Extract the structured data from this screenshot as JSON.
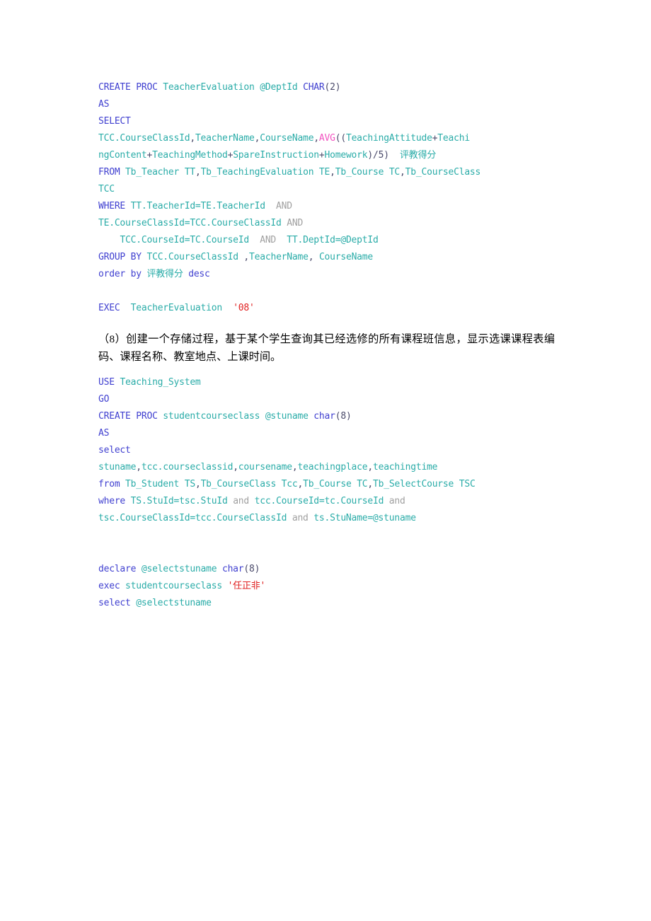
{
  "document": {
    "language": "zh-CN",
    "page_background": "#ffffff",
    "syntax_colors": {
      "keyword": "#4040D0",
      "identifier": "#2AACA8",
      "function": "#F252C0",
      "string": "#E02020",
      "operator_gray": "#A0A0A0",
      "punctuation": "#4a4a6a",
      "prose": "#000000"
    }
  },
  "blocks": [
    {
      "name": "teacher-evaluation-procedure",
      "type": "code",
      "lines": [
        [
          {
            "t": "CREATE",
            "c": "kw"
          },
          {
            "t": " ",
            "c": "pun"
          },
          {
            "t": "PROC",
            "c": "kw"
          },
          {
            "t": " ",
            "c": "pun"
          },
          {
            "t": "TeacherEvaluation",
            "c": "id"
          },
          {
            "t": " ",
            "c": "pun"
          },
          {
            "t": "@DeptId",
            "c": "id"
          },
          {
            "t": " ",
            "c": "pun"
          },
          {
            "t": "CHAR",
            "c": "kw"
          },
          {
            "t": "(2)",
            "c": "pun"
          }
        ],
        [
          {
            "t": "AS",
            "c": "kw"
          }
        ],
        [
          {
            "t": "SELECT",
            "c": "kw"
          }
        ],
        [
          {
            "t": "TCC.CourseClassId",
            "c": "id"
          },
          {
            "t": ",",
            "c": "pun"
          },
          {
            "t": "TeacherName",
            "c": "id"
          },
          {
            "t": ",",
            "c": "pun"
          },
          {
            "t": "CourseName",
            "c": "id"
          },
          {
            "t": ",",
            "c": "pun"
          },
          {
            "t": "AVG",
            "c": "fn"
          },
          {
            "t": "((",
            "c": "pun"
          },
          {
            "t": "TeachingAttitude",
            "c": "id"
          },
          {
            "t": "+",
            "c": "pun"
          },
          {
            "t": "Teachi",
            "c": "id"
          }
        ],
        [
          {
            "t": "ngContent",
            "c": "id"
          },
          {
            "t": "+",
            "c": "pun"
          },
          {
            "t": "TeachingMethod",
            "c": "id"
          },
          {
            "t": "+",
            "c": "pun"
          },
          {
            "t": "SpareInstruction",
            "c": "id"
          },
          {
            "t": "+",
            "c": "pun"
          },
          {
            "t": "Homework",
            "c": "id"
          },
          {
            "t": ")/5)",
            "c": "pun"
          },
          {
            "t": "  ",
            "c": "pun"
          },
          {
            "t": "评教得分",
            "c": "id"
          }
        ],
        [
          {
            "t": "FROM",
            "c": "kw"
          },
          {
            "t": " ",
            "c": "pun"
          },
          {
            "t": "Tb_Teacher",
            "c": "id"
          },
          {
            "t": " ",
            "c": "pun"
          },
          {
            "t": "TT",
            "c": "id"
          },
          {
            "t": ",",
            "c": "pun"
          },
          {
            "t": "Tb_TeachingEvaluation",
            "c": "id"
          },
          {
            "t": " ",
            "c": "pun"
          },
          {
            "t": "TE",
            "c": "id"
          },
          {
            "t": ",",
            "c": "pun"
          },
          {
            "t": "Tb_Course",
            "c": "id"
          },
          {
            "t": " ",
            "c": "pun"
          },
          {
            "t": "TC",
            "c": "id"
          },
          {
            "t": ",",
            "c": "pun"
          },
          {
            "t": "Tb_CourseClass",
            "c": "id"
          }
        ],
        [
          {
            "t": "TCC",
            "c": "id"
          }
        ],
        [
          {
            "t": "WHERE",
            "c": "kw"
          },
          {
            "t": " ",
            "c": "pun"
          },
          {
            "t": "TT.TeacherId=TE.TeacherId",
            "c": "id"
          },
          {
            "t": "  ",
            "c": "pun"
          },
          {
            "t": "AND",
            "c": "gry"
          }
        ],
        [
          {
            "t": "TE.CourseClassId=TCC.CourseClassId",
            "c": "id"
          },
          {
            "t": " ",
            "c": "pun"
          },
          {
            "t": "AND",
            "c": "gry"
          }
        ],
        [
          {
            "t": "    ",
            "c": "pun"
          },
          {
            "t": "TCC.CourseId=TC.CourseId",
            "c": "id"
          },
          {
            "t": "  ",
            "c": "pun"
          },
          {
            "t": "AND",
            "c": "gry"
          },
          {
            "t": "  ",
            "c": "pun"
          },
          {
            "t": "TT.DeptId=@DeptId",
            "c": "id"
          }
        ],
        [
          {
            "t": "GROUP",
            "c": "kw"
          },
          {
            "t": " ",
            "c": "pun"
          },
          {
            "t": "BY",
            "c": "kw"
          },
          {
            "t": " ",
            "c": "pun"
          },
          {
            "t": "TCC.CourseClassId",
            "c": "id"
          },
          {
            "t": " ,",
            "c": "pun"
          },
          {
            "t": "TeacherName",
            "c": "id"
          },
          {
            "t": ", ",
            "c": "pun"
          },
          {
            "t": "CourseName",
            "c": "id"
          }
        ],
        [
          {
            "t": "order",
            "c": "kw"
          },
          {
            "t": " ",
            "c": "pun"
          },
          {
            "t": "by",
            "c": "kw"
          },
          {
            "t": " ",
            "c": "pun"
          },
          {
            "t": "评教得分",
            "c": "id"
          },
          {
            "t": " ",
            "c": "pun"
          },
          {
            "t": "desc",
            "c": "kw"
          }
        ],
        [],
        [
          {
            "t": "EXEC",
            "c": "kw"
          },
          {
            "t": "  ",
            "c": "pun"
          },
          {
            "t": "TeacherEvaluation",
            "c": "id"
          },
          {
            "t": "  ",
            "c": "pun"
          },
          {
            "t": "'08'",
            "c": "str"
          }
        ]
      ]
    },
    {
      "name": "question-8-prose",
      "type": "prose",
      "text": "（8）创建一个存储过程，基于某个学生查询其已经选修的所有课程班信息，显示选课课程表编码、课程名称、教室地点、上课时间。"
    },
    {
      "name": "studentcourseclass-procedure",
      "type": "code",
      "lines": [
        [
          {
            "t": "USE",
            "c": "kw"
          },
          {
            "t": " ",
            "c": "pun"
          },
          {
            "t": "Teaching_System",
            "c": "id"
          }
        ],
        [
          {
            "t": "GO",
            "c": "kw"
          }
        ],
        [
          {
            "t": "CREATE",
            "c": "kw"
          },
          {
            "t": " ",
            "c": "pun"
          },
          {
            "t": "PROC",
            "c": "kw"
          },
          {
            "t": " ",
            "c": "pun"
          },
          {
            "t": "studentcourseclass",
            "c": "id"
          },
          {
            "t": " ",
            "c": "pun"
          },
          {
            "t": "@stuname",
            "c": "id"
          },
          {
            "t": " ",
            "c": "pun"
          },
          {
            "t": "char",
            "c": "kw"
          },
          {
            "t": "(8)",
            "c": "pun"
          }
        ],
        [
          {
            "t": "AS",
            "c": "kw"
          }
        ],
        [
          {
            "t": "select",
            "c": "kw"
          }
        ],
        [
          {
            "t": "stuname",
            "c": "id"
          },
          {
            "t": ",",
            "c": "pun"
          },
          {
            "t": "tcc.courseclassid",
            "c": "id"
          },
          {
            "t": ",",
            "c": "pun"
          },
          {
            "t": "coursename",
            "c": "id"
          },
          {
            "t": ",",
            "c": "pun"
          },
          {
            "t": "teachingplace",
            "c": "id"
          },
          {
            "t": ",",
            "c": "pun"
          },
          {
            "t": "teachingtime",
            "c": "id"
          }
        ],
        [
          {
            "t": "from",
            "c": "kw"
          },
          {
            "t": " ",
            "c": "pun"
          },
          {
            "t": "Tb_Student",
            "c": "id"
          },
          {
            "t": " ",
            "c": "pun"
          },
          {
            "t": "TS",
            "c": "id"
          },
          {
            "t": ",",
            "c": "pun"
          },
          {
            "t": "Tb_CourseClass",
            "c": "id"
          },
          {
            "t": " ",
            "c": "pun"
          },
          {
            "t": "Tcc",
            "c": "id"
          },
          {
            "t": ",",
            "c": "pun"
          },
          {
            "t": "Tb_Course",
            "c": "id"
          },
          {
            "t": " ",
            "c": "pun"
          },
          {
            "t": "TC",
            "c": "id"
          },
          {
            "t": ",",
            "c": "pun"
          },
          {
            "t": "Tb_SelectCourse",
            "c": "id"
          },
          {
            "t": " ",
            "c": "pun"
          },
          {
            "t": "TSC",
            "c": "id"
          }
        ],
        [
          {
            "t": "where",
            "c": "kw"
          },
          {
            "t": " ",
            "c": "pun"
          },
          {
            "t": "TS.StuId=tsc.StuId",
            "c": "id"
          },
          {
            "t": " ",
            "c": "pun"
          },
          {
            "t": "and",
            "c": "gry"
          },
          {
            "t": " ",
            "c": "pun"
          },
          {
            "t": "tcc.CourseId=tc.CourseId",
            "c": "id"
          },
          {
            "t": " ",
            "c": "pun"
          },
          {
            "t": "and",
            "c": "gry"
          }
        ],
        [
          {
            "t": "tsc.CourseClassId=tcc.CourseClassId",
            "c": "id"
          },
          {
            "t": " ",
            "c": "pun"
          },
          {
            "t": "and",
            "c": "gry"
          },
          {
            "t": " ",
            "c": "pun"
          },
          {
            "t": "ts.StuName=@stuname",
            "c": "id"
          }
        ],
        [],
        [],
        [
          {
            "t": "declare",
            "c": "kw"
          },
          {
            "t": " ",
            "c": "pun"
          },
          {
            "t": "@selectstuname",
            "c": "id"
          },
          {
            "t": " ",
            "c": "pun"
          },
          {
            "t": "char",
            "c": "kw"
          },
          {
            "t": "(8)",
            "c": "pun"
          }
        ],
        [
          {
            "t": "exec",
            "c": "kw"
          },
          {
            "t": " ",
            "c": "pun"
          },
          {
            "t": "studentcourseclass",
            "c": "id"
          },
          {
            "t": " ",
            "c": "pun"
          },
          {
            "t": "'任正非'",
            "c": "str"
          }
        ],
        [
          {
            "t": "select",
            "c": "kw"
          },
          {
            "t": " ",
            "c": "pun"
          },
          {
            "t": "@selectstuname",
            "c": "id"
          }
        ]
      ]
    }
  ]
}
